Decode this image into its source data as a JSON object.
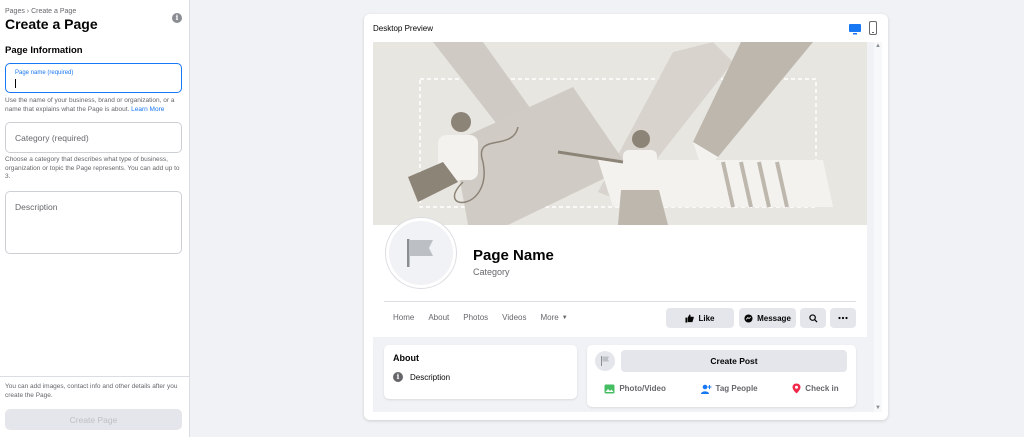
{
  "left_panel": {
    "breadcrumb": "Pages › Create a Page",
    "title": "Create a Page",
    "section_heading": "Page Information",
    "name_field": {
      "label": "Page name (required)",
      "value": ""
    },
    "name_help": "Use the name of your business, brand or organization, or a name that explains what the Page is about.",
    "name_help_link": "Learn More",
    "category_field": {
      "placeholder": "Category (required)"
    },
    "category_help": "Choose a category that describes what type of business, organization or topic the Page represents. You can add up to 3.",
    "description_field": {
      "placeholder": "Description"
    },
    "bottom_note": "You can add images, contact info and other details after you create the Page.",
    "create_button": "Create Page"
  },
  "preview": {
    "label": "Desktop Preview",
    "page_name": "Page Name",
    "category": "Category",
    "nav_tabs": [
      "Home",
      "About",
      "Photos",
      "Videos"
    ],
    "nav_more": "More",
    "like_label": "Like",
    "message_label": "Message",
    "about": {
      "title": "About",
      "description": "Description"
    },
    "post": {
      "create_label": "Create Post",
      "actions": [
        "Photo/Video",
        "Tag People",
        "Check in"
      ]
    }
  },
  "colors": {
    "accent": "#1877f2",
    "cover_bg": "#e8e6e1",
    "photo_green": "#45bd62",
    "tag_blue": "#1877f2",
    "checkin_red": "#f02849"
  }
}
